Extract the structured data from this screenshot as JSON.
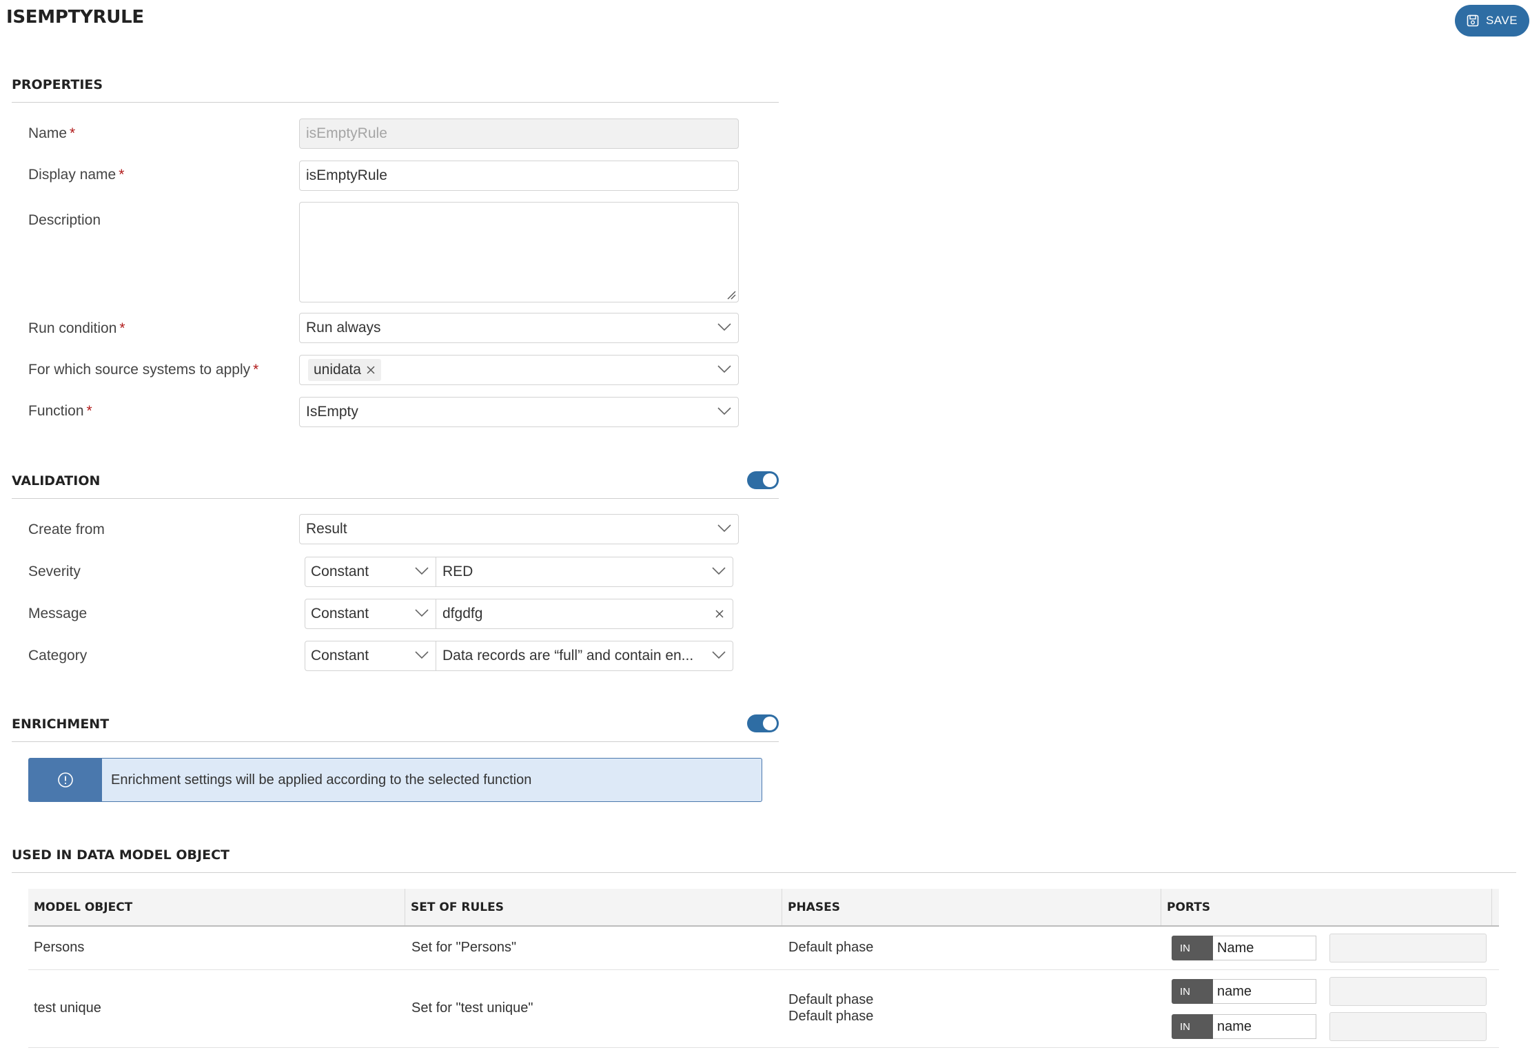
{
  "header": {
    "title": "ISEMPTYRULE",
    "save_label": "SAVE"
  },
  "properties": {
    "title": "PROPERTIES",
    "name_label": "Name",
    "name_value": "isEmptyRule",
    "display_name_label": "Display name",
    "display_name_value": "isEmptyRule",
    "description_label": "Description",
    "description_value": "",
    "run_condition_label": "Run condition",
    "run_condition_value": "Run always",
    "source_systems_label": "For which source systems to apply",
    "source_systems_chip": "unidata",
    "function_label": "Function",
    "function_value": "IsEmpty",
    "required_mark": "*"
  },
  "validation": {
    "title": "VALIDATION",
    "enabled": true,
    "create_from_label": "Create from",
    "create_from_value": "Result",
    "severity_label": "Severity",
    "severity_type": "Constant",
    "severity_value": "RED",
    "message_label": "Message",
    "message_type": "Constant",
    "message_value": "dfgdfg",
    "category_label": "Category",
    "category_type": "Constant",
    "category_value": "Data records are “full” and contain en..."
  },
  "enrichment": {
    "title": "ENRICHMENT",
    "enabled": true,
    "info_text": "Enrichment settings will be applied according to the selected function"
  },
  "used_in": {
    "title": "USED IN DATA MODEL OBJECT",
    "columns": [
      "MODEL OBJECT",
      "SET OF RULES",
      "PHASES",
      "PORTS"
    ],
    "rows": [
      {
        "model_object": "Persons",
        "set_of_rules": "Set for \"Persons\"",
        "phases": [
          "Default phase"
        ],
        "ports": [
          {
            "direction": "IN",
            "value": "Name"
          }
        ]
      },
      {
        "model_object": "test unique",
        "set_of_rules": "Set for \"test unique\"",
        "phases": [
          "Default phase",
          "Default phase"
        ],
        "ports": [
          {
            "direction": "IN",
            "value": "name"
          },
          {
            "direction": "IN",
            "value": "name"
          }
        ]
      }
    ]
  },
  "colors": {
    "accent": "#2e6da4",
    "required": "#b11b1b",
    "info_bg": "#dde9f7",
    "info_bar": "#4a78ad"
  },
  "icons": [
    "save-icon",
    "chevron-down-icon",
    "close-icon",
    "info-icon",
    "resize-handle-icon"
  ]
}
